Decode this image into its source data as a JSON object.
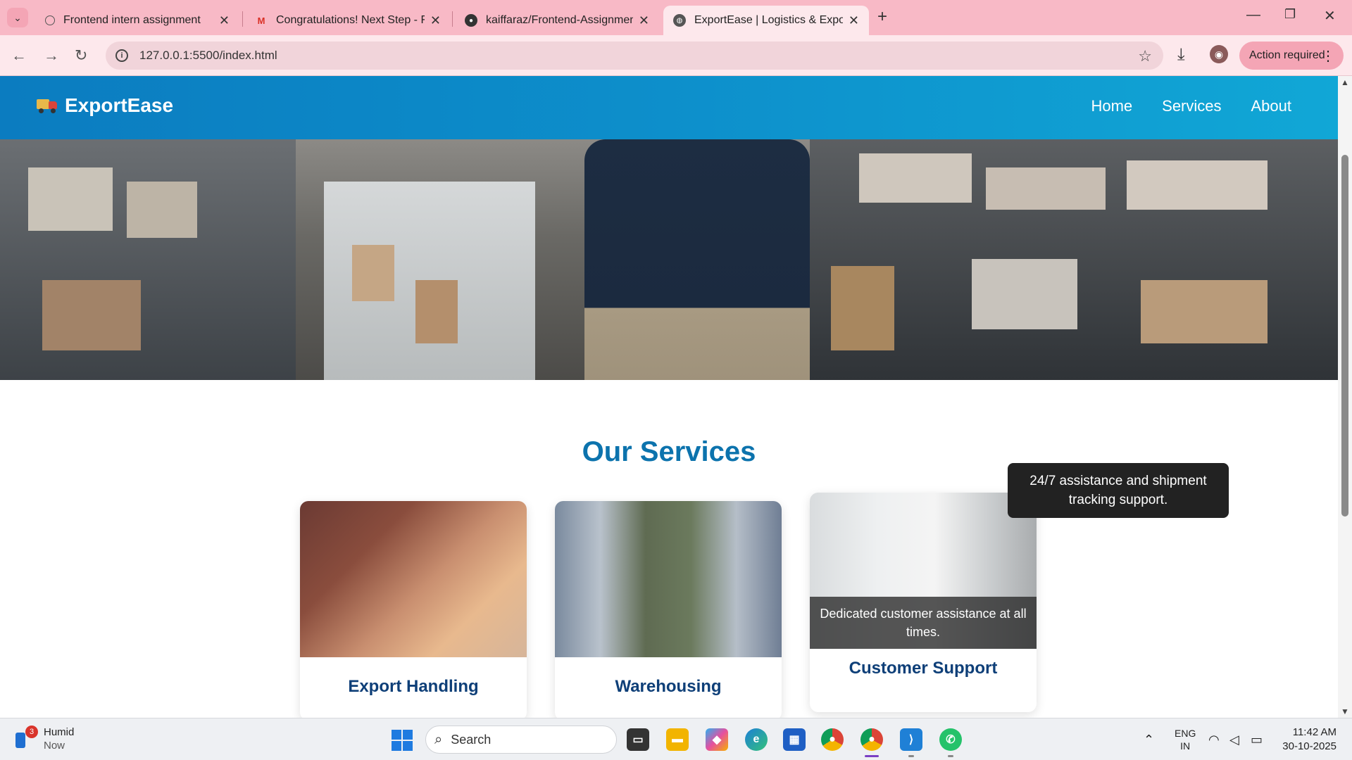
{
  "browser": {
    "tabs": [
      {
        "title": "Frontend intern assignment",
        "icon": "chatgpt-icon"
      },
      {
        "title": "Congratulations! Next Step - Fr",
        "icon": "gmail-icon"
      },
      {
        "title": "kaiffaraz/Frontend-Assignment",
        "icon": "github-icon"
      },
      {
        "title": "ExportEase | Logistics & Export",
        "icon": "globe-icon"
      }
    ],
    "url": "127.0.0.1:5500/index.html",
    "action_required": "Action required"
  },
  "site": {
    "brand": "ExportEase",
    "nav": [
      "Home",
      "Services",
      "About"
    ],
    "services_title": "Our Services",
    "cards": [
      {
        "title": "Export Handling"
      },
      {
        "title": "Warehousing"
      },
      {
        "title": "Customer Support",
        "overlay": "Dedicated customer assistance at all times."
      }
    ],
    "tooltip": "24/7 assistance and shipment tracking support."
  },
  "taskbar": {
    "weather": {
      "label": "Humid",
      "sub": "Now",
      "badge": "3"
    },
    "search_placeholder": "Search",
    "lang_top": "ENG",
    "lang_bottom": "IN",
    "time": "11:42 AM",
    "date": "30-10-2025"
  },
  "colors": {
    "tabbar": "#f8b9c6",
    "header_gradient_start": "#0b7cc0",
    "header_gradient_end": "#11a7d6",
    "services_title": "#0c73ad",
    "card_title": "#0e3f78"
  }
}
